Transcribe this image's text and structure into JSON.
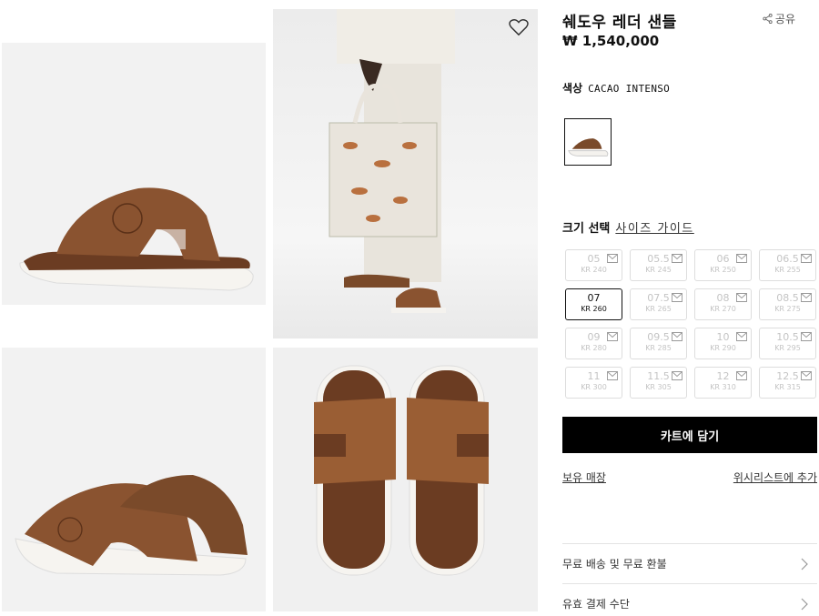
{
  "product": {
    "title": "쉐도우 레더 샌들",
    "price": "₩ 1,540,000",
    "share_label": "공유"
  },
  "color": {
    "label": "색상",
    "value": "CACAO INTENSO"
  },
  "size": {
    "label": "크기 선택",
    "guide_label": "사이즈 가이드",
    "selected": "07",
    "options": [
      {
        "eu": "05",
        "kr": "KR 240"
      },
      {
        "eu": "05.5",
        "kr": "KR 245"
      },
      {
        "eu": "06",
        "kr": "KR 250"
      },
      {
        "eu": "06.5",
        "kr": "KR 255"
      },
      {
        "eu": "07",
        "kr": "KR 260"
      },
      {
        "eu": "07.5",
        "kr": "KR 265"
      },
      {
        "eu": "08",
        "kr": "KR 270"
      },
      {
        "eu": "08.5",
        "kr": "KR 275"
      },
      {
        "eu": "09",
        "kr": "KR 280"
      },
      {
        "eu": "09.5",
        "kr": "KR 285"
      },
      {
        "eu": "10",
        "kr": "KR 290"
      },
      {
        "eu": "10.5",
        "kr": "KR 295"
      },
      {
        "eu": "11",
        "kr": "KR 300"
      },
      {
        "eu": "11.5",
        "kr": "KR 305"
      },
      {
        "eu": "12",
        "kr": "KR 310"
      },
      {
        "eu": "12.5",
        "kr": "KR 315"
      }
    ]
  },
  "actions": {
    "add_to_cart": "카트에 담기",
    "stores": "보유 매장",
    "wishlist": "위시리스트에 추가"
  },
  "accordion": [
    {
      "label": "무료 배송 및 무료 환불"
    },
    {
      "label": "유효 결제 수단"
    }
  ],
  "colors": {
    "leather": "#7a4a2a",
    "sole": "#f4f2ee",
    "button_bg": "#000000"
  }
}
